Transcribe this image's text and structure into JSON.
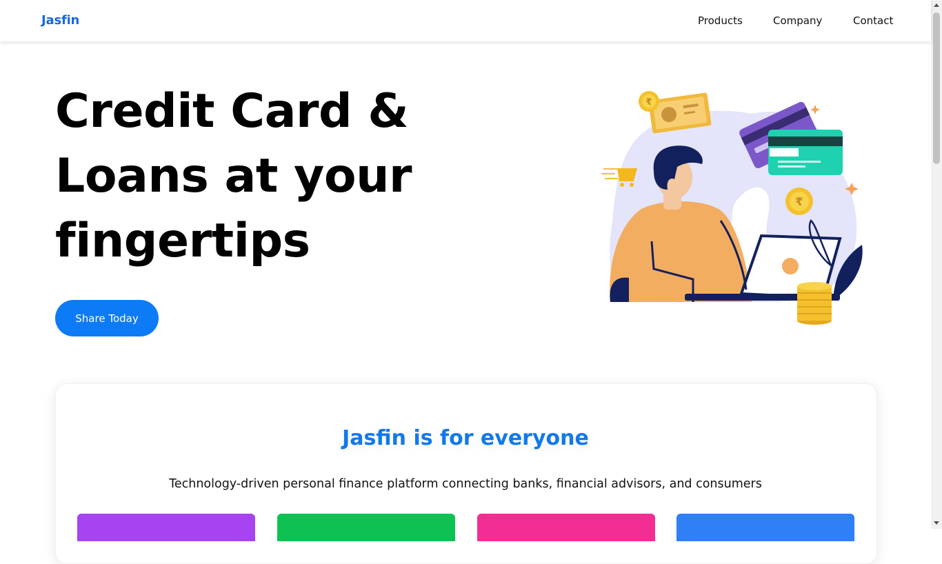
{
  "nav": {
    "brand": "Jasfin",
    "links": [
      "Products",
      "Company",
      "Contact"
    ]
  },
  "hero": {
    "title": "Credit Card & Loans at your fingertips",
    "cta": "Share Today"
  },
  "about": {
    "title": "Jasfin is for everyone",
    "subtitle": "Technology-driven personal finance platform connecting banks, financial advisors, and consumers"
  },
  "colors": {
    "brand": "#1668e3",
    "accent": "#0d7bf5",
    "card_colors": [
      "#a743f0",
      "#0fc152",
      "#f22e92",
      "#2f7ff7"
    ]
  },
  "icons": {
    "illustration": "person-with-laptop-credit-card-coins-illustration"
  }
}
